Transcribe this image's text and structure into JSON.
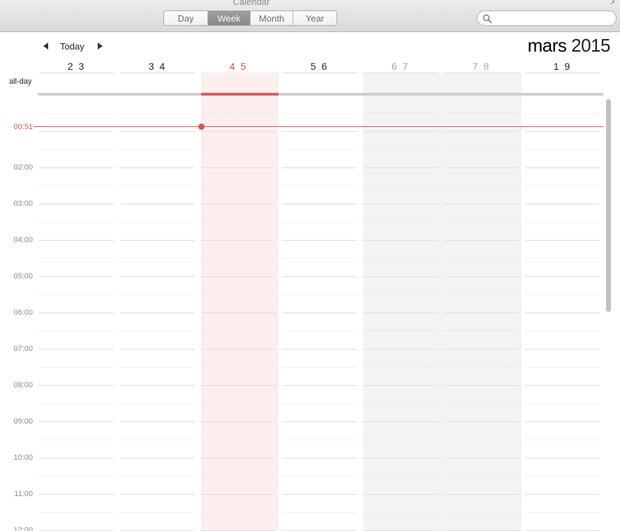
{
  "window": {
    "title": "Calendar"
  },
  "toolbar": {
    "views": [
      {
        "label": "Day",
        "active": false
      },
      {
        "label": "Week",
        "active": true
      },
      {
        "label": "Month",
        "active": false
      },
      {
        "label": "Year",
        "active": false
      }
    ],
    "search": {
      "placeholder": "",
      "value": ""
    }
  },
  "nav": {
    "today_label": "Today",
    "month": "mars",
    "year": "2015"
  },
  "days": [
    {
      "label": "2 3",
      "state": "normal"
    },
    {
      "label": "3 4",
      "state": "normal"
    },
    {
      "label": "4 5",
      "state": "today"
    },
    {
      "label": "5 6",
      "state": "normal"
    },
    {
      "label": "6 7",
      "state": "weekend"
    },
    {
      "label": "7 8",
      "state": "weekend"
    },
    {
      "label": "1 9",
      "state": "normal"
    }
  ],
  "allday_label": "all-day",
  "now_time": "00:51",
  "hours": [
    "02:00",
    "03:00",
    "04:00",
    "05:00",
    "06:00",
    "07:00",
    "08:00",
    "09:00",
    "10:00",
    "11:00",
    "12:00"
  ],
  "colors": {
    "today": "#d75656",
    "today_bg": "#fdeeee",
    "weekend_bg": "#f3f3f3",
    "accent_segment": "#8a8a8a"
  }
}
